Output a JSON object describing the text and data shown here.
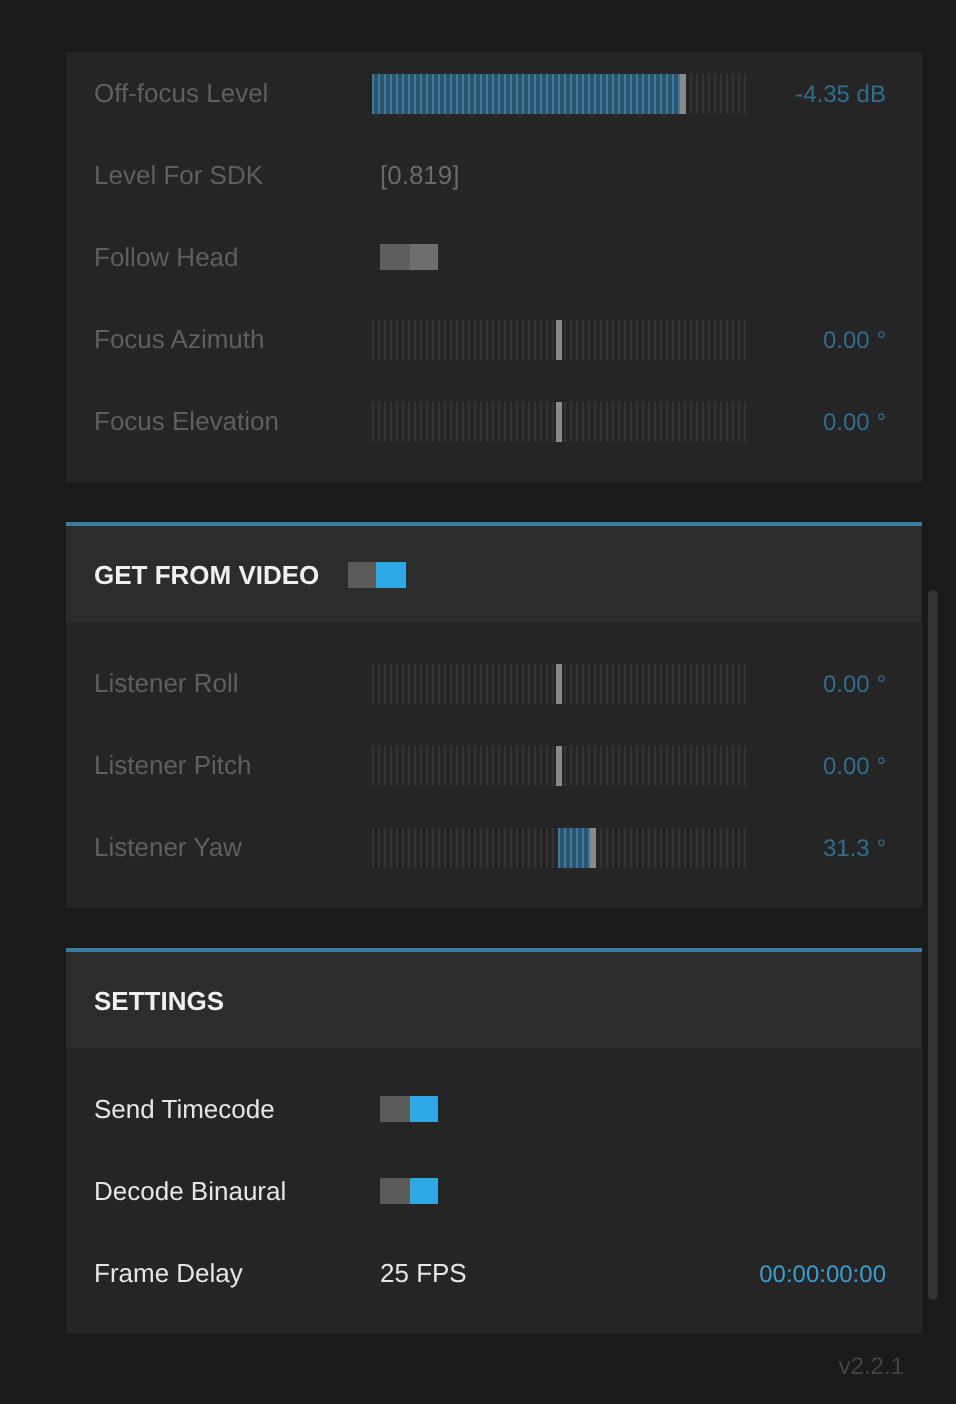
{
  "sections": [
    {
      "rows": [
        {
          "kind": "level_slider",
          "label": "Off-focus Level",
          "disabled": true,
          "level": 0.83,
          "reading": "-4.35 dB"
        },
        {
          "kind": "readout",
          "label": "Level For SDK",
          "disabled": true,
          "value": "[0.819]"
        },
        {
          "kind": "toggle",
          "label": "Follow Head",
          "disabled": true,
          "on": false
        },
        {
          "kind": "center_slider",
          "label": "Focus Azimuth",
          "disabled": true,
          "level": 0.5,
          "reading": "0.00 °"
        },
        {
          "kind": "center_slider",
          "label": "Focus Elevation",
          "disabled": true,
          "level": 0.5,
          "reading": "0.00 °"
        }
      ]
    },
    {
      "title": "GET FROM VIDEO",
      "toggle": {
        "on": true
      },
      "rows": [
        {
          "kind": "center_slider",
          "label": "Listener Roll",
          "disabled": true,
          "level": 0.5,
          "reading": "0.00 °"
        },
        {
          "kind": "center_slider",
          "label": "Listener Pitch",
          "disabled": true,
          "level": 0.5,
          "reading": "0.00 °"
        },
        {
          "kind": "center_slider",
          "label": "Listener Yaw",
          "disabled": true,
          "level": 0.59,
          "reading": "31.3 °"
        }
      ]
    },
    {
      "title": "SETTINGS",
      "rows": [
        {
          "kind": "toggle",
          "label": "Send Timecode",
          "disabled": false,
          "on": true
        },
        {
          "kind": "toggle",
          "label": "Decode Binaural",
          "disabled": false,
          "on": true
        },
        {
          "kind": "readout",
          "label": "Frame Delay",
          "disabled": false,
          "value": "25 FPS",
          "reading": "00:00:00:00"
        }
      ]
    }
  ],
  "version": "v2.2.1"
}
